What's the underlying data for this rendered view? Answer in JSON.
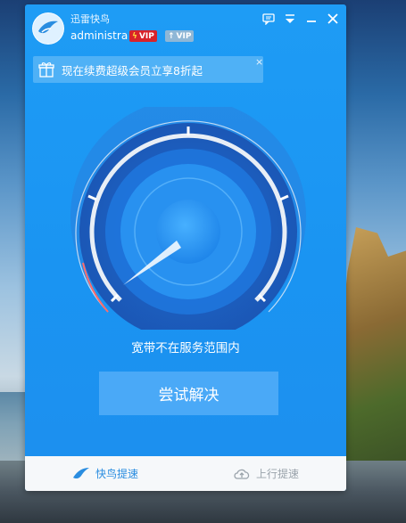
{
  "app": {
    "name": "迅雷快鸟",
    "username": "administra",
    "badges": {
      "down_vip": "VIP",
      "up_vip": "VIP"
    }
  },
  "toolbar": {
    "icons": [
      "feedback-icon",
      "dropdown-menu-icon",
      "minimize-icon",
      "close-icon"
    ]
  },
  "promo": {
    "text": "现在续费超级会员立享8折起",
    "close": "×"
  },
  "gauge": {
    "level": 0.0,
    "colors": {
      "ring": "#e8eef6",
      "accent": "#ff6b6b"
    }
  },
  "main": {
    "status": "宽带不在服务范围内",
    "action_label": "尝试解决"
  },
  "tabs": [
    {
      "label": "快鸟提速",
      "icon": "bird-icon",
      "active": true
    },
    {
      "label": "上行提速",
      "icon": "cloud-upload-icon",
      "active": false
    }
  ],
  "colors": {
    "window": "#1e9cf5",
    "button": "#4aa9f7",
    "tab_active": "#2a8de0",
    "tab_inactive": "#9aa3ab",
    "vip_red": "#d8232a"
  }
}
